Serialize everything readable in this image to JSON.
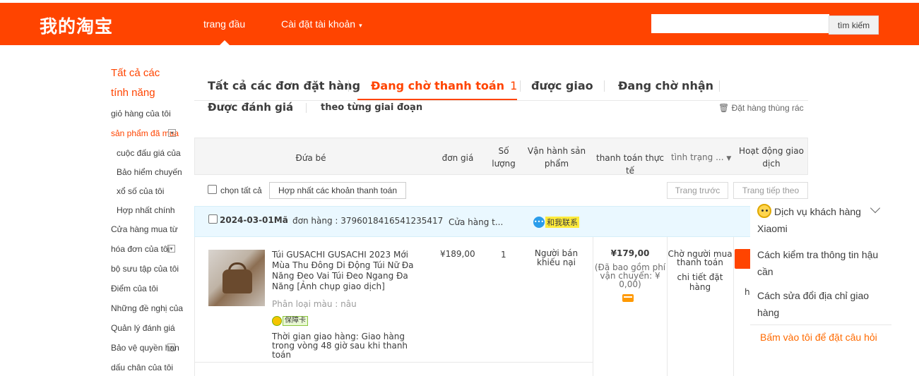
{
  "header": {
    "logo": "我的淘宝",
    "nav_home": "trang đầu",
    "nav_account": "Cài đặt tài khoản",
    "search_placeholder": "",
    "search_button": "tìm kiếm"
  },
  "sidebar": {
    "title_line1": "Tất cả các",
    "title_line2": "tính năng",
    "items": [
      {
        "label": "giỏ hàng của tôi"
      },
      {
        "label": "sản phẩm đã mua"
      },
      {
        "label": "cuộc đấu giá của"
      },
      {
        "label": "Bảo hiểm chuyến"
      },
      {
        "label": "xổ số của tôi"
      },
      {
        "label": "Hợp nhất chính"
      },
      {
        "label": "Cửa hàng mua từ"
      },
      {
        "label": "hóa đơn của tôi"
      },
      {
        "label": "bộ sưu tập của tôi"
      },
      {
        "label": "Điểm của tôi"
      },
      {
        "label": "Những đề nghị của"
      },
      {
        "label": "Quản lý đánh giá"
      },
      {
        "label": "Bảo vệ quyền hạn"
      },
      {
        "label": "dấu chân của tôi"
      }
    ]
  },
  "tabs": {
    "all": "Tất cả các đơn đặt hàng",
    "pending_payment": "Đang chờ thanh toán",
    "pending_count": "1",
    "delivered": "được giao",
    "awaiting": "Đang chờ nhận",
    "review": "Được đánh giá",
    "by_stage": "theo từng giai đoạn",
    "trash": "Đặt hàng thùng rác"
  },
  "table_header": {
    "product": "Đứa bé",
    "unit_price": "đơn giá",
    "quantity_l1": "Số",
    "quantity_l2": "lượng",
    "operation_l1": "Vận hành sản",
    "operation_l2": "phẩm",
    "actual_payment": "thanh toán thực tế",
    "status": "tình trạng ...",
    "trade_l1": "Hoạt động giao",
    "trade_l2": "dịch"
  },
  "toolbar": {
    "select_all": "chọn tất cả",
    "merge_pay": "Hợp nhất các khoản thanh toán",
    "prev": "Trang trước",
    "next": "Trang tiếp theo"
  },
  "order": {
    "date": "2024-03-01Mã",
    "order_no": "đơn hàng : 3796018416541235417",
    "shop": "Cửa hàng t...",
    "chat_label": "和我联系",
    "product_name": "Túi GUSACHI GUSACHI 2023 Mới Mùa Thu Đông Di Động Túi Nữ Đa Năng Đeo Vai Túi Đeo Ngang Đa Năng [Ảnh chụp giao dịch]",
    "variant": "Phân loại màu : nâu",
    "guarantee_badge": "保障卡",
    "delivery": "Thời gian giao hàng: Giao hàng trong vòng 48 giờ sau khi thanh toán",
    "unit_price": "¥189,00",
    "quantity": "1",
    "operation": "Người bán khiếu nại",
    "total": "¥179,00",
    "shipping_note": "(Đã bao gồm phí vận chuyển: ¥ 0,00)",
    "status": "Chờ người mua thanh toán",
    "detail": "chi tiết đặt hàng",
    "stub_h": "h"
  },
  "help_panel": {
    "service": "Dịch vụ khách hàng Xiaomi",
    "q1": "Cách kiểm tra thông tin hậu cần",
    "q2": "Cách sửa đổi địa chỉ giao hàng",
    "ask": "Bấm vào tôi để đặt câu hỏi"
  },
  "colors": {
    "brand": "#ff4400",
    "accent_text": "#ff6a00",
    "order_head_bg": "#eaf8ff"
  }
}
